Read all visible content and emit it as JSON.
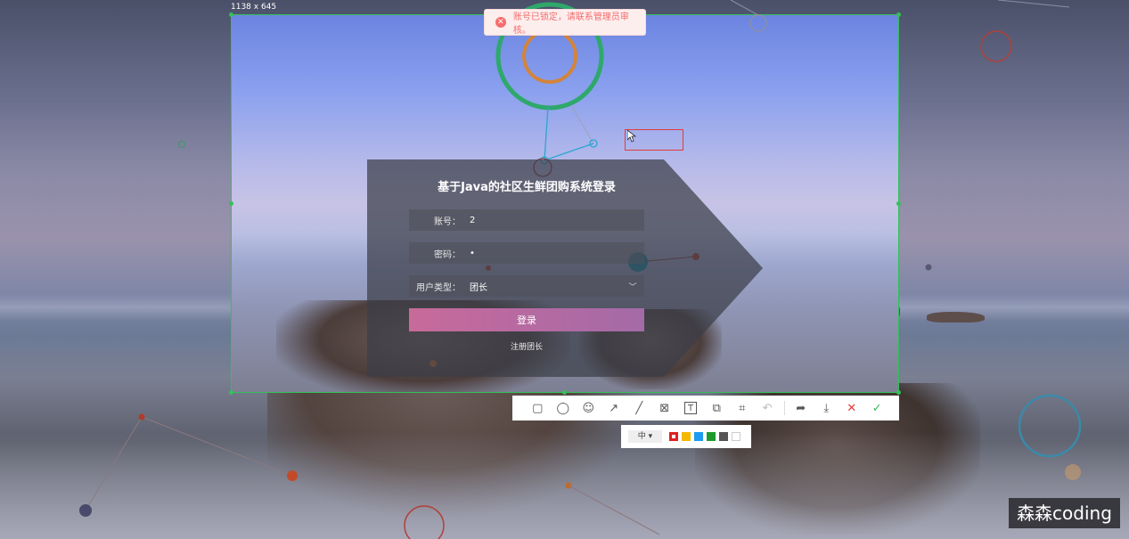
{
  "screenshot_tool": {
    "size_label": "1138 x 645",
    "toolbar_tools": [
      {
        "name": "rectangle-icon",
        "glyph": "▢"
      },
      {
        "name": "ellipse-icon",
        "glyph": "◯"
      },
      {
        "name": "emoji-icon",
        "glyph": "☺"
      },
      {
        "name": "arrow-icon",
        "glyph": "↗"
      },
      {
        "name": "line-icon",
        "glyph": "╱"
      },
      {
        "name": "mosaic-icon",
        "glyph": "⊠"
      },
      {
        "name": "text-icon",
        "glyph": "T"
      },
      {
        "name": "copy-icon",
        "glyph": "⧉"
      },
      {
        "name": "ocr-icon",
        "glyph": "⌗"
      },
      {
        "name": "undo-icon",
        "glyph": "↶"
      },
      {
        "name": "share-icon",
        "glyph": "➦"
      },
      {
        "name": "download-icon",
        "glyph": "⤓"
      },
      {
        "name": "cancel-icon",
        "glyph": "✕"
      },
      {
        "name": "confirm-icon",
        "glyph": "✓"
      }
    ],
    "size_selector": "中 ▾",
    "colors": [
      "#e02020",
      "#f5b800",
      "#1e9bf0",
      "#1f9a2e",
      "#555555",
      "#ffffff"
    ],
    "selected_color": "#e02020",
    "accent": "#34c05a"
  },
  "toast": {
    "icon": "✕",
    "message": "账号已锁定，请联系管理员审核。",
    "color": "#f56c6c"
  },
  "login": {
    "title": "基于Java的社区生鲜团购系统登录",
    "account_label": "账号：",
    "account_value": "2",
    "password_label": "密码：",
    "password_value": "•",
    "user_type_label": "用户类型：",
    "user_type_value": "团长",
    "login_button": "登录",
    "register_link": "注册团长"
  },
  "watermark": "森森coding"
}
